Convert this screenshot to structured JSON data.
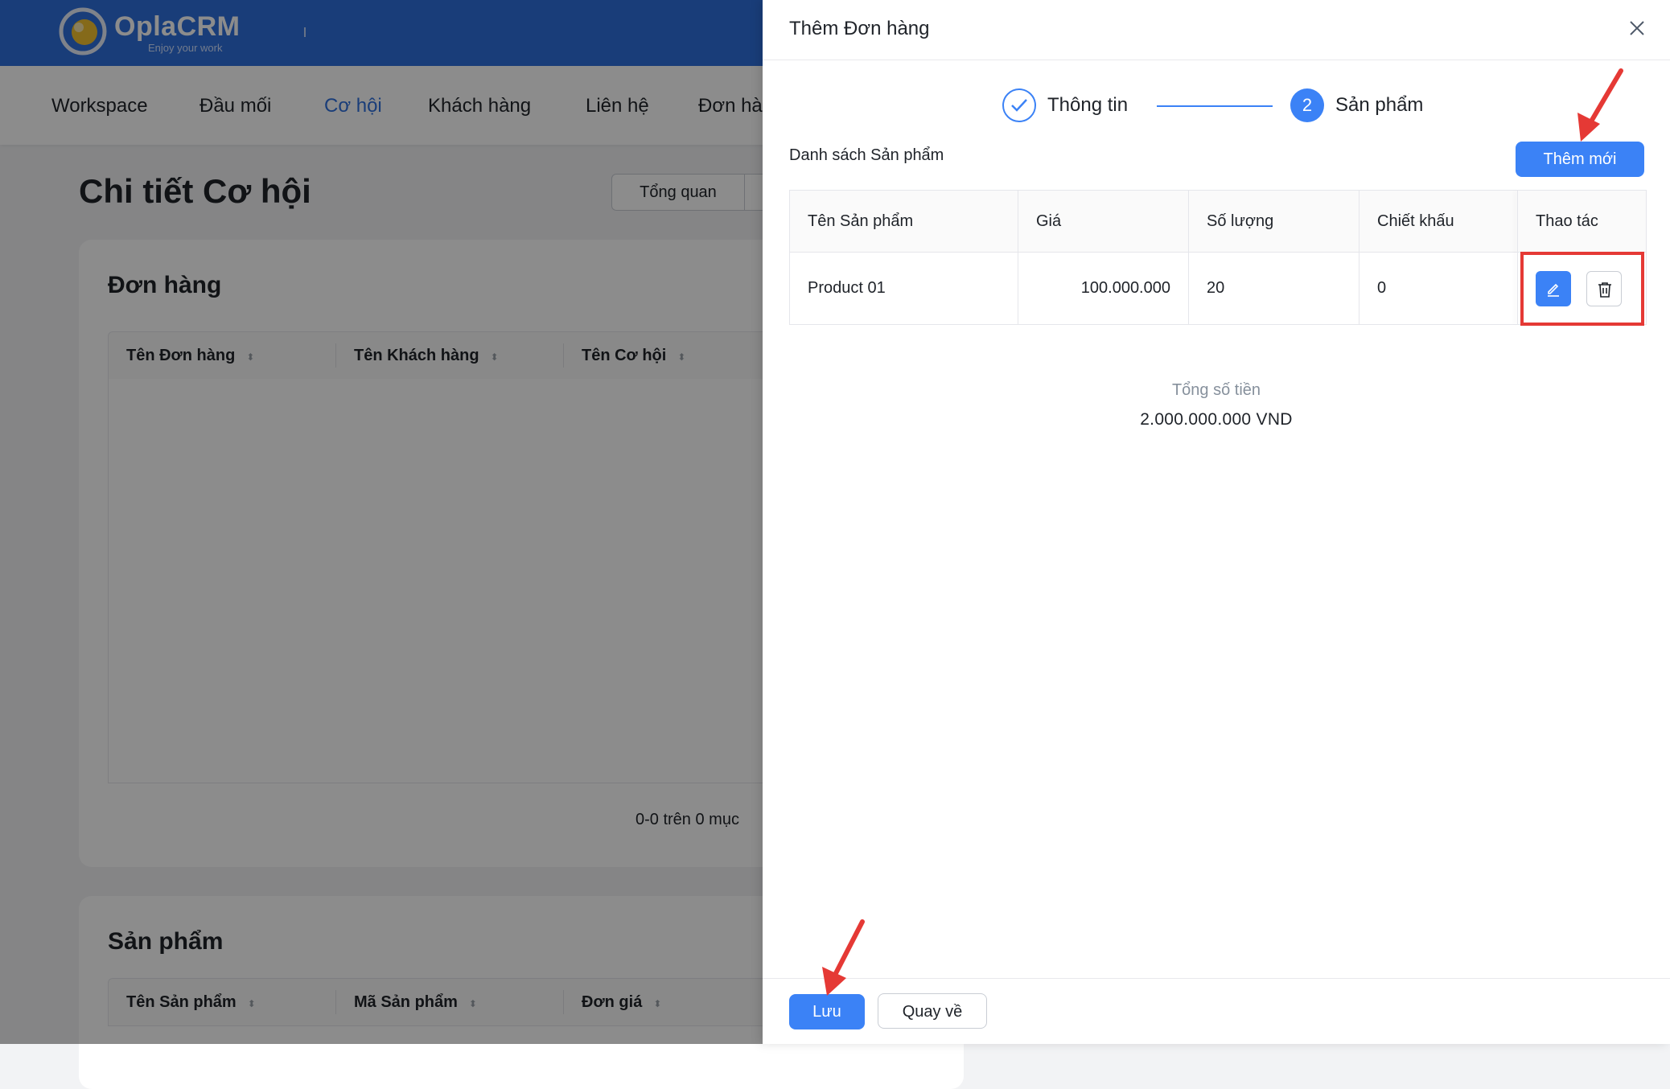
{
  "app": {
    "brand": "OplaCRM",
    "tagline": "Enjoy your work"
  },
  "nav": {
    "items": [
      {
        "label": "Workspace"
      },
      {
        "label": "Đầu mối"
      },
      {
        "label": "Cơ hội"
      },
      {
        "label": "Khách hàng"
      },
      {
        "label": "Liên hệ"
      },
      {
        "label": "Đơn hà"
      }
    ],
    "active_index": 2
  },
  "page": {
    "title": "Chi tiết Cơ hội",
    "tab_overview": "Tổng quan"
  },
  "orders_card": {
    "title": "Đơn hàng",
    "columns": [
      "Tên Đơn hàng",
      "Tên Khách hàng",
      "Tên Cơ hội"
    ],
    "pagination": "0-0 trên 0 mục"
  },
  "products_card": {
    "title": "Sản phẩm",
    "columns": [
      "Tên Sản phẩm",
      "Mã Sản phẩm",
      "Đơn giá"
    ]
  },
  "drawer": {
    "title": "Thêm Đơn hàng",
    "steps": [
      {
        "label": "Thông tin",
        "state": "done"
      },
      {
        "number": "2",
        "label": "Sản phẩm",
        "state": "active"
      }
    ],
    "section_label": "Danh sách Sản phẩm",
    "add_button": "Thêm mới",
    "table": {
      "columns": [
        "Tên Sản phẩm",
        "Giá",
        "Số lượng",
        "Chiết khấu",
        "Thao tác"
      ],
      "rows": [
        {
          "name": "Product 01",
          "price": "100.000.000",
          "quantity": "20",
          "discount": "0"
        }
      ]
    },
    "total_label": "Tổng số tiền",
    "total_value": "2.000.000.000 VND",
    "save_button": "Lưu",
    "back_button": "Quay về"
  },
  "colors": {
    "primary": "#3b82f6",
    "header": "#2f6fdc",
    "annotation": "#e53935"
  }
}
